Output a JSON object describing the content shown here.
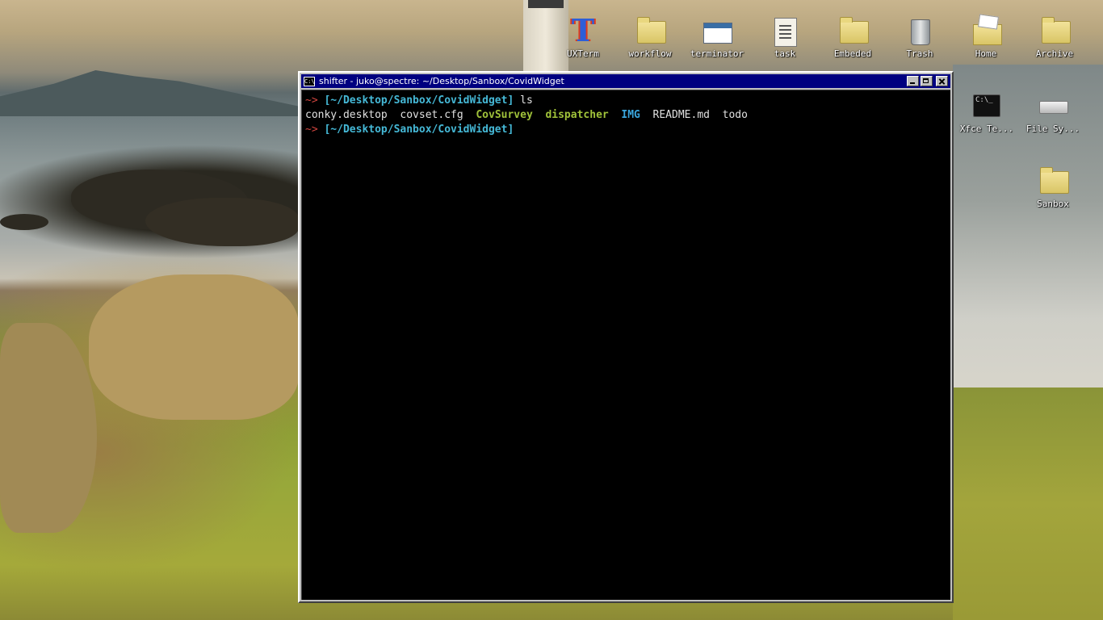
{
  "desktop": {
    "icons": [
      {
        "label": "UXTerm"
      },
      {
        "label": "workflow"
      },
      {
        "label": "terminator"
      },
      {
        "label": "task"
      },
      {
        "label": "Embeded"
      },
      {
        "label": "Trash"
      },
      {
        "label": "Home"
      },
      {
        "label": "Archive"
      },
      {
        "label": "Xfce Te..."
      },
      {
        "label": "File Sy..."
      },
      {
        "label": "Sanbox"
      }
    ]
  },
  "terminal": {
    "title": "shifter - juko@spectre: ~/Desktop/Sanbox/CovidWidget",
    "app_icon_text": "C:\\",
    "lines": [
      {
        "arrow": "~>",
        "path": "[~/Desktop/Sanbox/CovidWidget]",
        "command": "ls"
      },
      {
        "files": [
          "conky.desktop",
          "covset.cfg",
          "CovSurvey",
          "dispatcher",
          "IMG",
          "README.md",
          "todo"
        ]
      },
      {
        "arrow": "~>",
        "path": "[~/Desktop/Sanbox/CovidWidget]",
        "command": ""
      }
    ]
  },
  "colors": {
    "titlebar": "#000080",
    "prompt_arrow": "#d2453f",
    "path": "#45b8d6",
    "executable": "#a0c23a",
    "directory": "#3aa6de"
  }
}
